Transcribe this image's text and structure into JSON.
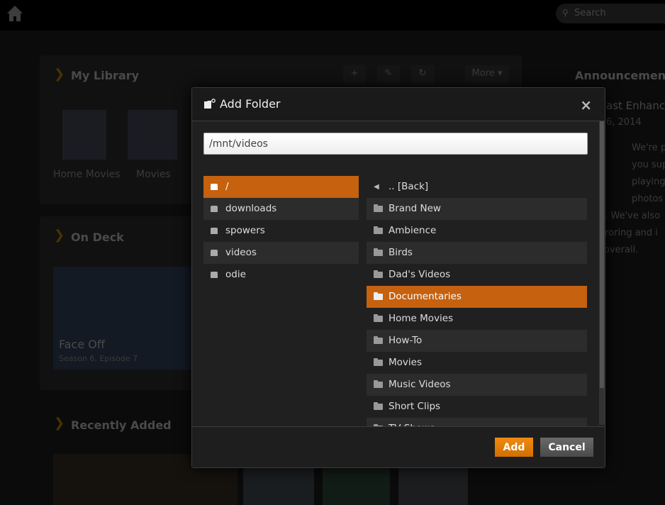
{
  "topbar": {
    "search_placeholder": "Search"
  },
  "background": {
    "my_library": "My Library",
    "library_items": [
      "Home Movies",
      "Movies"
    ],
    "toolbar": {
      "add": "+",
      "edit": "✎",
      "refresh": "↻",
      "more": "More ▾"
    },
    "on_deck": "On Deck",
    "on_deck_item": {
      "title": "Face Off",
      "subtitle": "Season 6, Episode 7"
    },
    "recently_added": "Recently Added",
    "announcements": "Announcements",
    "announcement_title": "ast Enhance",
    "announcement_date": "6, 2014",
    "announcement_lines": [
      "We're p",
      "you sup",
      "playing",
      "photos",
      "t. We've also",
      "rroring and i",
      "overall."
    ]
  },
  "dialog": {
    "title": "Add Folder",
    "close": "×",
    "path_value": "/mnt/videos",
    "roots": [
      {
        "label": "/",
        "selected": true
      },
      {
        "label": "downloads"
      },
      {
        "label": "spowers"
      },
      {
        "label": "videos"
      },
      {
        "label": "odie"
      }
    ],
    "back_label": ".. [Back]",
    "folders": [
      {
        "label": "Brand New"
      },
      {
        "label": "Ambience"
      },
      {
        "label": "Birds"
      },
      {
        "label": "Dad's Videos"
      },
      {
        "label": "Documentaries",
        "selected": true
      },
      {
        "label": "Home Movies"
      },
      {
        "label": "How-To"
      },
      {
        "label": "Movies"
      },
      {
        "label": "Music Videos"
      },
      {
        "label": "Short Clips"
      },
      {
        "label": "TV Shows"
      }
    ],
    "add_label": "Add",
    "cancel_label": "Cancel"
  },
  "colors": {
    "accent": "#c5610f",
    "add_button": "#e57d08"
  }
}
